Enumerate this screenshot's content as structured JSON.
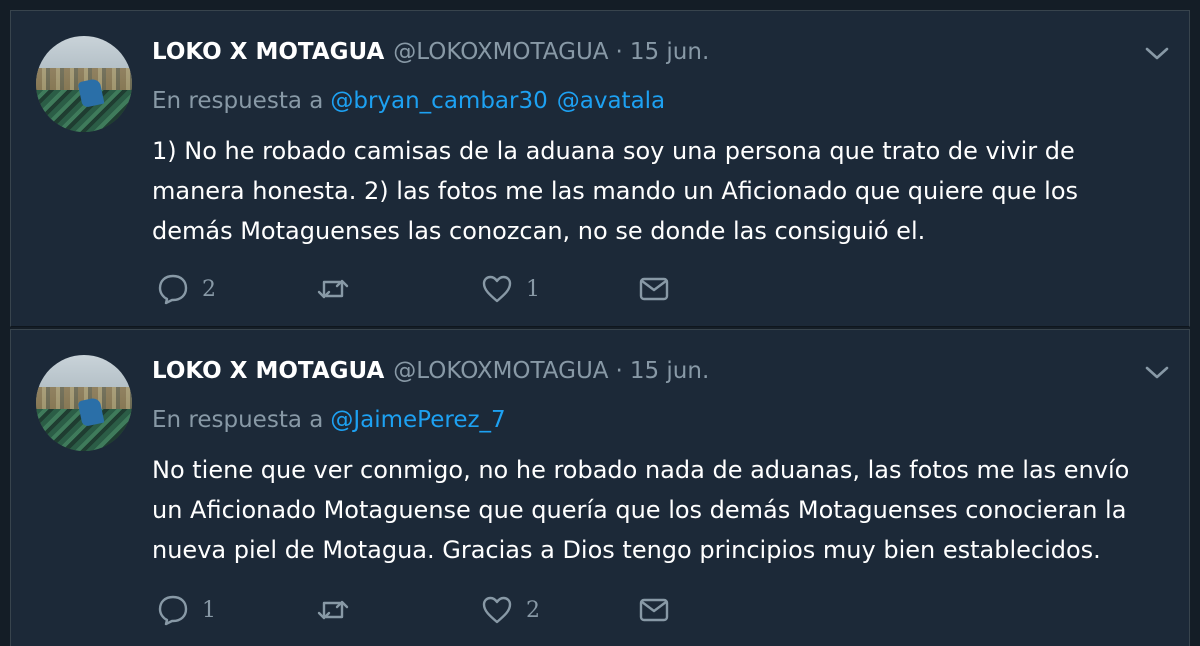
{
  "tweets": [
    {
      "name": "LOKO X MOTAGUA",
      "handle": "@LOKOXMOTAGUA",
      "separator": "·",
      "time": "15 jun.",
      "reply_prefix": "En respuesta a",
      "mentions": [
        "@bryan_cambar30",
        "@avatala"
      ],
      "text": "1) No he robado camisas de la aduana soy una persona que trato de vivir de manera honesta. 2) las fotos me las mando un Aficionado que quiere que los demás Motaguenses las conozcan, no se donde las consiguió el.",
      "reply_count": "2",
      "retweet_count": "",
      "like_count": "1"
    },
    {
      "name": "LOKO X MOTAGUA",
      "handle": "@LOKOXMOTAGUA",
      "separator": "·",
      "time": "15 jun.",
      "reply_prefix": "En respuesta a",
      "mentions": [
        "@JaimePerez_7"
      ],
      "text": "No tiene que ver conmigo, no he robado nada de aduanas, las fotos me las envío un Aficionado Motaguense que quería que los demás Motaguenses conocieran la nueva piel de Motagua. Gracias a Dios tengo principios muy bien establecidos.",
      "reply_count": "1",
      "retweet_count": "",
      "like_count": "2"
    }
  ],
  "icons": {
    "reply": "speech-bubble-icon",
    "retweet": "retweet-arrows-icon",
    "like": "heart-icon",
    "dm": "envelope-icon",
    "more": "chevron-down-icon"
  },
  "colors": {
    "background": "#141d26",
    "card": "#1c2938",
    "secondary_text": "#8899a6",
    "link": "#1da1f2",
    "primary_text": "#ffffff"
  }
}
